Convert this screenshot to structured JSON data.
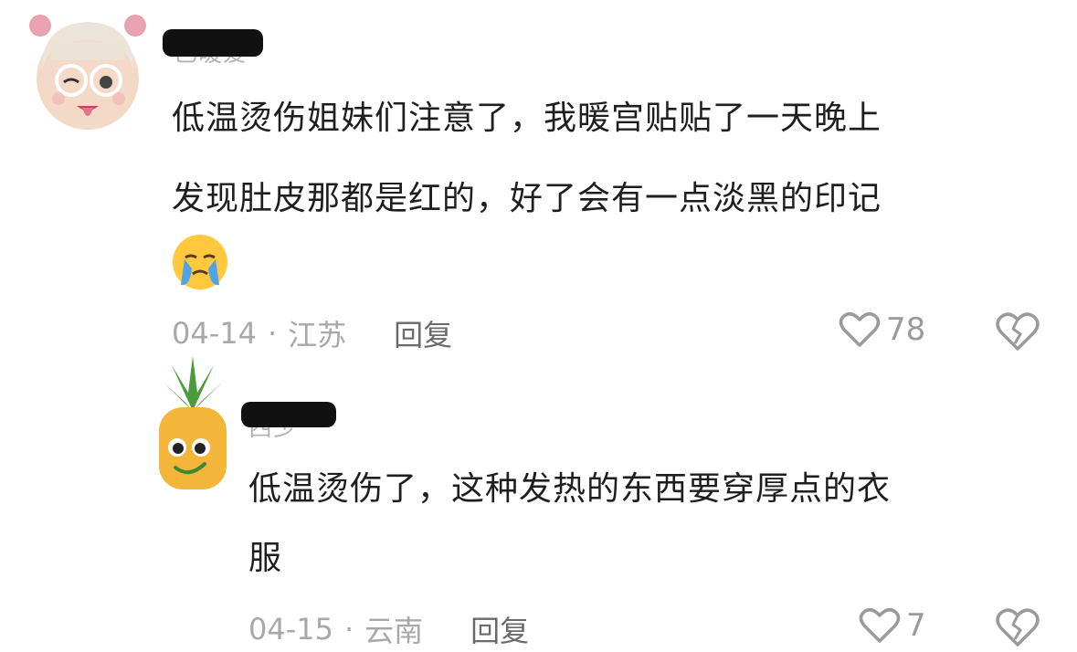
{
  "comments": [
    {
      "username": "已暖爱",
      "text_lines": [
        "低温烫伤姐妹们注意了，我暖宫贴贴了一天晚上",
        "发现肚皮那都是红的，好了会有一点淡黑的印记"
      ],
      "emoji": "crying-face",
      "date": "04-14",
      "location": "江苏",
      "separator": "·",
      "reply_label": "回复",
      "likes": "78",
      "avatar": "memoji-girl-avatar"
    },
    {
      "username": "西少",
      "text_lines": [
        "低温烫伤了，这种发热的东西要穿厚点的衣",
        "服"
      ],
      "date": "04-15",
      "location": "云南",
      "separator": "·",
      "reply_label": "回复",
      "likes": "7",
      "avatar": "pineapple-avatar"
    }
  ],
  "colors": {
    "meta_gray": "#a8a8a8",
    "reply_gray": "#6a6a6a",
    "text": "#1e1e1e"
  }
}
